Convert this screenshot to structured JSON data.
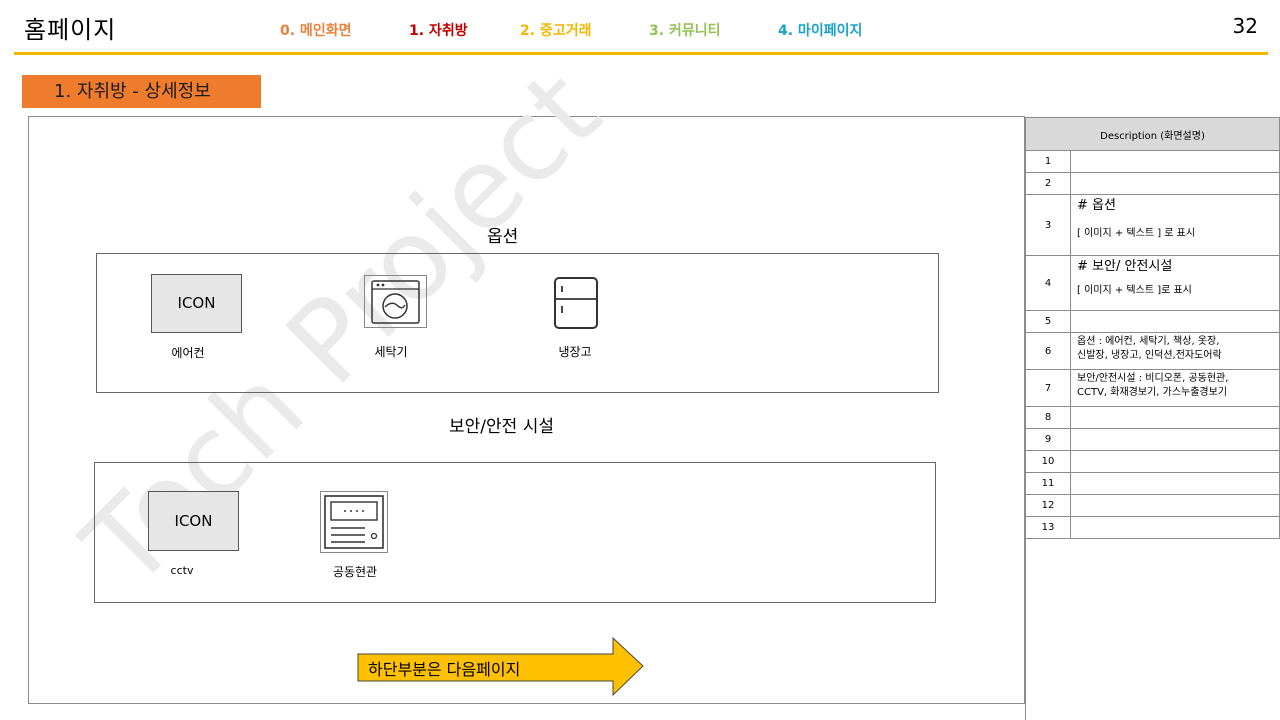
{
  "header": {
    "title": "홈페이지",
    "page_number": "32",
    "nav": [
      {
        "label": "0. 메인화면",
        "color": "#e8823a"
      },
      {
        "label": "1. 자취방",
        "color": "#c00000"
      },
      {
        "label": "2. 중고거래",
        "color": "#f2b800"
      },
      {
        "label": "3. 커뮤니티",
        "color": "#92c353"
      },
      {
        "label": "4. 마이페이지",
        "color": "#1aa3c8"
      }
    ],
    "accent": "#f2b800"
  },
  "section_badge": "1. 자취방 - 상세정보",
  "section_badge_color": "#ef7c2c",
  "watermark": "Toch Project",
  "options": {
    "heading": "옵션",
    "items": [
      {
        "caption": "에어컨",
        "placeholder": "ICON"
      },
      {
        "caption": "세탁기",
        "icon": "washing-machine-icon"
      },
      {
        "caption": "냉장고",
        "icon": "refrigerator-icon"
      }
    ]
  },
  "security": {
    "heading": "보안/안전 시설",
    "items": [
      {
        "caption": "cctv",
        "placeholder": "ICON"
      },
      {
        "caption": "공동현관",
        "icon": "intercom-panel-icon"
      }
    ]
  },
  "next_arrow": {
    "label": "하단부분은 다음페이지",
    "color": "#ffc000"
  },
  "description": {
    "header": "Description (화면설명)",
    "rows": [
      {
        "num": "1",
        "lines": []
      },
      {
        "num": "2",
        "lines": []
      },
      {
        "num": "3",
        "lines": [
          "# 옵션",
          "[ 이미지 + 텍스트 ] 로 표시"
        ]
      },
      {
        "num": "4",
        "lines": [
          "# 보안/ 안전시설",
          "[ 이미지 + 텍스트 ]로 표시"
        ]
      },
      {
        "num": "5",
        "lines": []
      },
      {
        "num": "6",
        "lines": [
          "옵션 : 에어컨, 세탁기, 책상, 옷장,",
          "신발장, 냉장고, 인덕션,전자도어락"
        ]
      },
      {
        "num": "7",
        "lines": [
          "보안/안전시설 : 비디오폰, 공동현관,",
          "CCTV, 화재경보기, 가스누출경보기"
        ]
      },
      {
        "num": "8",
        "lines": []
      },
      {
        "num": "9",
        "lines": []
      },
      {
        "num": "10",
        "lines": []
      },
      {
        "num": "11",
        "lines": []
      },
      {
        "num": "12",
        "lines": []
      },
      {
        "num": "13",
        "lines": []
      }
    ]
  }
}
